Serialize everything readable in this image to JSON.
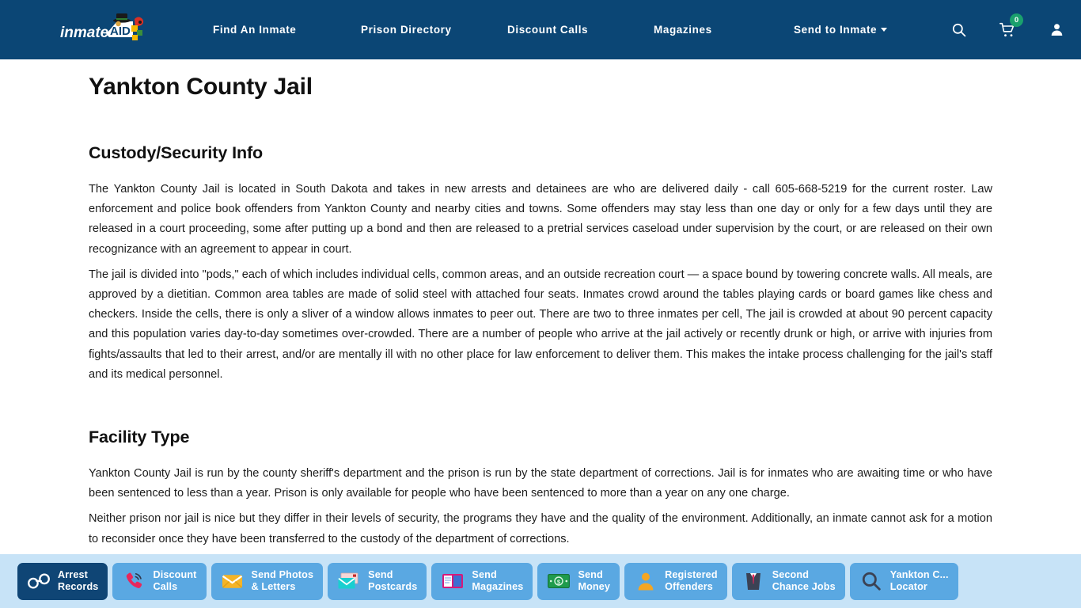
{
  "header": {
    "logo_text_primary": "inmate",
    "logo_text_secondary": "AID",
    "nav": [
      {
        "label": "Find An Inmate",
        "has_caret": false
      },
      {
        "label": "Prison Directory",
        "has_caret": false
      },
      {
        "label": "Discount Calls",
        "has_caret": false
      },
      {
        "label": "Magazines",
        "has_caret": false
      },
      {
        "label": "Send to Inmate",
        "has_caret": true
      }
    ],
    "icons": {
      "search": "search-icon",
      "cart": "cart-icon",
      "cart_count": "0",
      "account": "user-icon"
    },
    "colors": {
      "bar": "#0b4675",
      "badge": "#1aa06d"
    }
  },
  "main": {
    "page_title": "Yankton County Jail",
    "sections": [
      {
        "heading": "Custody/Security Info",
        "paragraphs": [
          "The Yankton County Jail is located in South Dakota and takes in new arrests and detainees are who are delivered daily - call 605-668-5219 for the current roster. Law enforcement and police book offenders from Yankton County and nearby cities and towns. Some offenders may stay less than one day or only for a few days until they are released in a court proceeding, some after putting up a bond and then are released to a pretrial services caseload under supervision by the court, or are released on their own recognizance with an agreement to appear in court.",
          "The jail is divided into \"pods,\" each of which includes individual cells, common areas, and an outside recreation court — a space bound by towering concrete walls. All meals, are approved by a dietitian. Common area tables are made of solid steel with attached four seats. Inmates crowd around the tables playing cards or board games like chess and checkers. Inside the cells, there is only a sliver of a window allows inmates to peer out. There are two to three inmates per cell, The jail is crowded at about 90 percent capacity and this population varies day-to-day sometimes over-crowded. There are a number of people who arrive at the jail actively or recently drunk or high, or arrive with injuries from fights/assaults that led to their arrest, and/or are mentally ill with no other place for law enforcement to deliver them. This makes the intake process challenging for the jail's staff and its medical personnel."
        ]
      },
      {
        "heading": "Facility Type",
        "paragraphs": [
          "Yankton County Jail is run by the county sheriff's department and the prison is run by the state department of corrections. Jail is for inmates who are awaiting time or who have been sentenced to less than a year. Prison is only available for people who have been sentenced to more than a year on any one charge.",
          "Neither prison nor jail is nice but they differ in their levels of security, the programs they have and the quality of the environment. Additionally, an inmate cannot ask for a motion to reconsider once they have been transferred to the custody of the department of corrections."
        ]
      }
    ]
  },
  "toolbar": {
    "background": "#c7e3f7",
    "buttons": [
      {
        "label": "Arrest\nRecords",
        "icon": "handcuffs-icon",
        "active": true
      },
      {
        "label": "Discount\nCalls",
        "icon": "phone-icon",
        "active": false
      },
      {
        "label": "Send Photos\n& Letters",
        "icon": "envelope-icon",
        "active": false
      },
      {
        "label": "Send\nPostcards",
        "icon": "postcard-icon",
        "active": false
      },
      {
        "label": "Send\nMagazines",
        "icon": "book-icon",
        "active": false
      },
      {
        "label": "Send\nMoney",
        "icon": "money-icon",
        "active": false
      },
      {
        "label": "Registered\nOffenders",
        "icon": "person-icon",
        "active": false
      },
      {
        "label": "Second\nChance Jobs",
        "icon": "suit-icon",
        "active": false
      },
      {
        "label": "Yankton C...\nLocator",
        "icon": "magnifier-icon",
        "active": false
      }
    ]
  }
}
